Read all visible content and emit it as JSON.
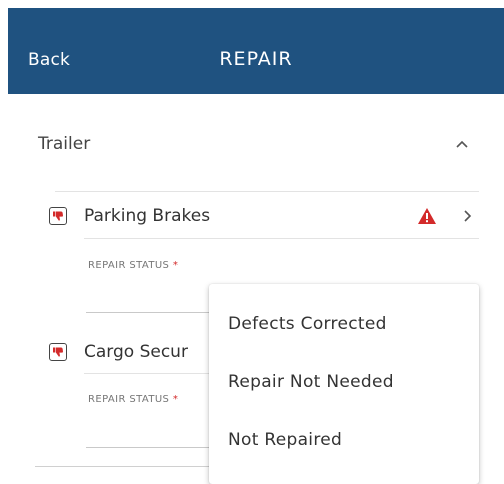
{
  "header": {
    "back_label": "Back",
    "title": "REPAIR"
  },
  "section": {
    "title": "Trailer"
  },
  "items": [
    {
      "label": "Parking Brakes",
      "field_label": "REPAIR STATUS",
      "required_mark": "*",
      "status": "fail",
      "warning": true
    },
    {
      "label": "Cargo Secur",
      "field_label": "REPAIR STATUS",
      "required_mark": "*",
      "status": "fail"
    }
  ],
  "dropdown": {
    "options": [
      "Defects Corrected",
      "Repair Not Needed",
      "Not Repaired"
    ]
  },
  "colors": {
    "header_bg": "#1f5280",
    "warning": "#d32a2a",
    "required": "#d32a2a"
  }
}
